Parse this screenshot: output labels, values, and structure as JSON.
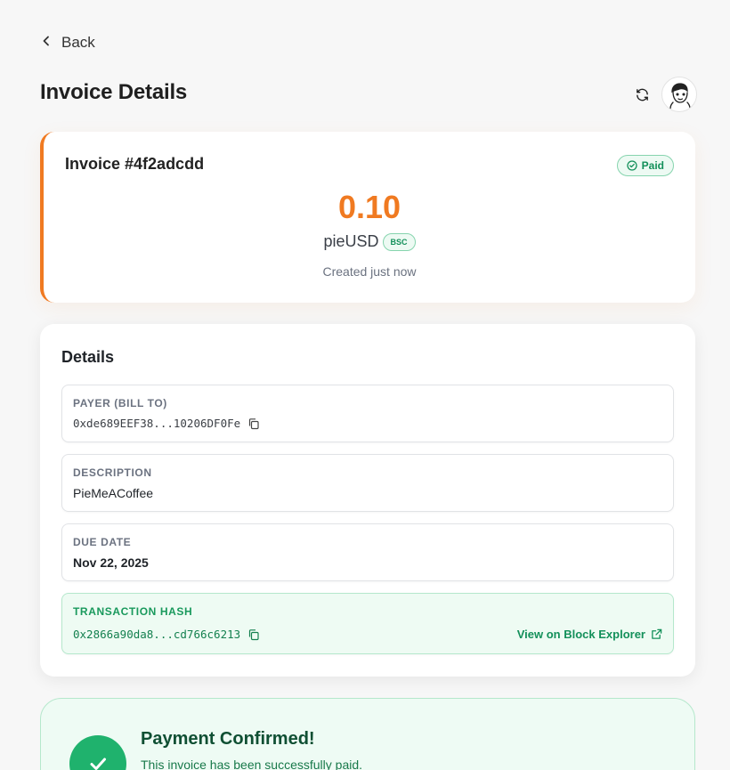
{
  "nav": {
    "back_label": "Back"
  },
  "page": {
    "title": "Invoice Details"
  },
  "header": {
    "refresh_icon": "refresh-icon",
    "avatar": "user-avatar"
  },
  "invoice": {
    "number": "Invoice #4f2adcdd",
    "status": "Paid",
    "amount": "0.10",
    "currency": "pieUSD",
    "chain": "BSC",
    "created": "Created just now"
  },
  "details": {
    "title": "Details",
    "payer": {
      "label": "PAYER (BILL TO)",
      "value": "0xde689EEF38...10206DF0Fe"
    },
    "description": {
      "label": "DESCRIPTION",
      "value": "PieMeACoffee"
    },
    "due_date": {
      "label": "DUE DATE",
      "value": "Nov 22, 2025"
    },
    "tx_hash": {
      "label": "TRANSACTION HASH",
      "value": "0x2866a90da8...cd766c6213",
      "explorer_label": "View on Block Explorer"
    }
  },
  "confirmation": {
    "title": "Payment Confirmed!",
    "subtitle": "This invoice has been successfully paid."
  },
  "colors": {
    "accent": "#f07a21",
    "success": "#1fb26d",
    "success_text": "#13905a",
    "background": "#f7f7f7"
  }
}
